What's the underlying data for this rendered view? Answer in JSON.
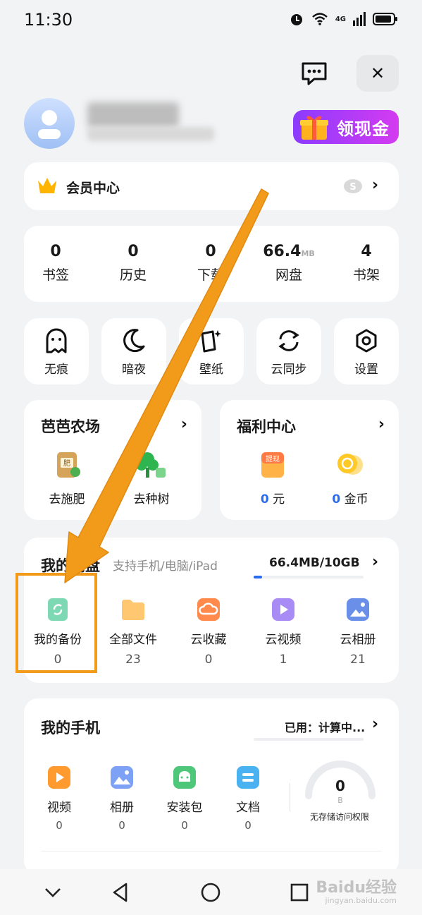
{
  "status": {
    "time": "11:30",
    "network": "4G"
  },
  "header": {
    "cash_button": "领现金"
  },
  "member": {
    "label": "会员中心"
  },
  "stats": [
    {
      "num": "0",
      "unit": "",
      "label": "书签"
    },
    {
      "num": "0",
      "unit": "",
      "label": "历史"
    },
    {
      "num": "0",
      "unit": "",
      "label": "下载"
    },
    {
      "num": "66.4",
      "unit": "MB",
      "label": "网盘"
    },
    {
      "num": "4",
      "unit": "",
      "label": "书架"
    }
  ],
  "tools": [
    {
      "label": "无痕",
      "icon": "ghost-icon"
    },
    {
      "label": "暗夜",
      "icon": "moon-icon"
    },
    {
      "label": "壁纸",
      "icon": "wallpaper-icon"
    },
    {
      "label": "云同步",
      "icon": "sync-icon"
    },
    {
      "label": "设置",
      "icon": "settings-icon"
    }
  ],
  "farm": {
    "title": "芭芭农场",
    "items": [
      {
        "label": "去施肥"
      },
      {
        "label": "去种树"
      }
    ],
    "fertilizer_text": "肥"
  },
  "welfare": {
    "title": "福利中心",
    "items": [
      {
        "value": "0",
        "unit": "元"
      },
      {
        "value": "0",
        "unit": "金币"
      }
    ],
    "withdraw_badge": "提现"
  },
  "disk": {
    "title": "我的网盘",
    "subtitle": "支持手机/电脑/iPad",
    "usage": "66.4MB/10GB",
    "usage_fraction": 0.0066,
    "items": [
      {
        "label": "我的备份",
        "count": "0"
      },
      {
        "label": "全部文件",
        "count": "23"
      },
      {
        "label": "云收藏",
        "count": "0"
      },
      {
        "label": "云视频",
        "count": "1"
      },
      {
        "label": "云相册",
        "count": "21"
      }
    ]
  },
  "phone": {
    "title": "我的手机",
    "used": "已用：计算中...",
    "items": [
      {
        "label": "视频",
        "count": "0"
      },
      {
        "label": "相册",
        "count": "0"
      },
      {
        "label": "安装包",
        "count": "0"
      },
      {
        "label": "文档",
        "count": "0"
      }
    ],
    "gauge_value": "0",
    "gauge_unit": "B",
    "no_access": "无存储访问权限"
  },
  "watermark": {
    "main": "Baidu经验",
    "sub": "jingyan.baidu.com"
  },
  "colors": {
    "accent_orange": "#f29a1a",
    "blue": "#2a6cf0",
    "purple": "#8b3bff"
  }
}
